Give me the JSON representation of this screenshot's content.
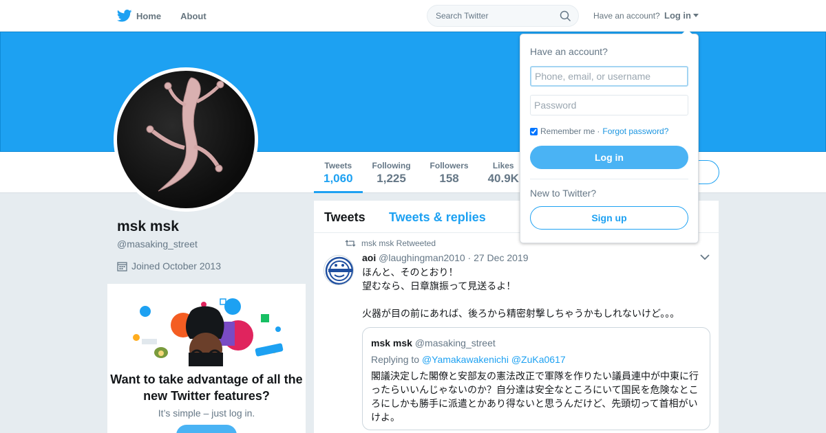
{
  "nav": {
    "home_label": "Home",
    "about_label": "About",
    "search_placeholder": "Search Twitter",
    "have_account": "Have an account?",
    "login_label": "Log in"
  },
  "profile": {
    "name": "msk msk",
    "handle": "@masaking_street",
    "joined": "Joined October 2013"
  },
  "stats": [
    {
      "label": "Tweets",
      "value": "1,060"
    },
    {
      "label": "Following",
      "value": "1,225"
    },
    {
      "label": "Followers",
      "value": "158"
    },
    {
      "label": "Likes",
      "value": "40.9K"
    }
  ],
  "promo": {
    "title": "Want to take advantage of all the new Twitter features?",
    "subtitle": "It’s simple – just log in."
  },
  "timeline": {
    "tabs": [
      "Tweets",
      "Tweets & replies"
    ],
    "tweet": {
      "retweet_label": "msk msk Retweeted",
      "author_name": "aoi",
      "author_handle": "@laughingman2010",
      "date": "· 27 Dec 2019",
      "text": "ほんと、そのとおり！\n望むなら、日章旗振って見送るよ！\n\n火器が目の前にあれば、後ろから精密射撃しちゃうかもしれないけど。。。",
      "quote": {
        "name": "msk msk",
        "handle": "@masaking_street",
        "replying_prefix": "Replying to",
        "replying_to": "@Yamakawakenichi @ZuKa0617",
        "text": "閣議決定した閣僚と安部友の憲法改正で軍隊を作りたい議員連中が中東に行ったらいいんじゃないのか？自分達は安全なところにいて国民を危険なところにしかも勝手に派遣とかあり得ないと思うんだけど、先頭切って首相がいけよ。"
      }
    }
  },
  "login_dropdown": {
    "title": "Have an account?",
    "username_placeholder": "Phone, email, or username",
    "password_placeholder": "Password",
    "remember_label": "Remember me",
    "separator": "·",
    "forgot_label": "Forgot password?",
    "login_button": "Log in",
    "new_label": "New to Twitter?",
    "signup_button": "Sign up"
  },
  "colors": {
    "brand": "#1da1f2",
    "button": "#4ab3f4",
    "background": "#e6ecf0"
  }
}
